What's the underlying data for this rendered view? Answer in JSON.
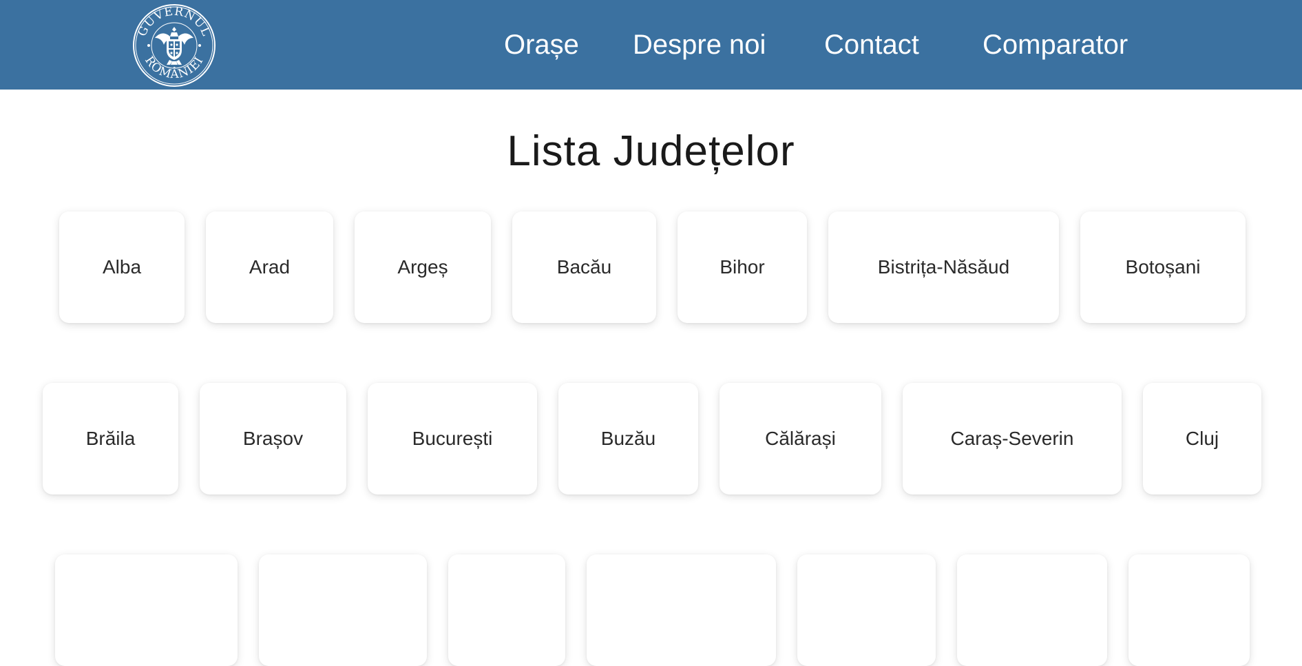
{
  "header": {
    "logo": {
      "top_text": "GUVERNUL",
      "bottom_text": "ROMÂNIEI",
      "icon": "romanian-coat-of-arms"
    },
    "nav": [
      {
        "label": "Orașe"
      },
      {
        "label": "Despre noi"
      },
      {
        "label": "Contact"
      },
      {
        "label": "Comparator"
      }
    ],
    "background_color": "#3b71a0"
  },
  "main": {
    "title": "Lista Județelor",
    "counties": [
      {
        "label": "Alba"
      },
      {
        "label": "Arad"
      },
      {
        "label": "Argeș"
      },
      {
        "label": "Bacău"
      },
      {
        "label": "Bihor"
      },
      {
        "label": "Bistrița-Năsăud"
      },
      {
        "label": "Botoșani"
      },
      {
        "label": "Brăila"
      },
      {
        "label": "Brașov"
      },
      {
        "label": "București"
      },
      {
        "label": "Buzău"
      },
      {
        "label": "Călărași"
      },
      {
        "label": "Caraș-Severin"
      },
      {
        "label": "Cluj"
      },
      {
        "label": ""
      },
      {
        "label": ""
      },
      {
        "label": ""
      },
      {
        "label": ""
      },
      {
        "label": ""
      },
      {
        "label": ""
      },
      {
        "label": ""
      }
    ]
  }
}
